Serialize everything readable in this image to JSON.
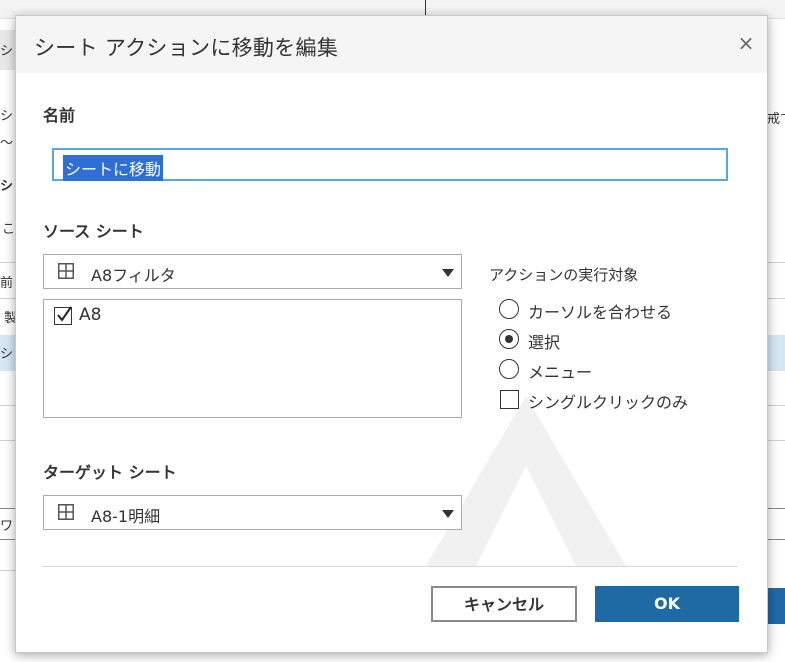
{
  "background": {
    "left_snippets": [
      "シ",
      "シ",
      "〜",
      "シ",
      "こ",
      "前",
      "製",
      "シ",
      "ワシ"
    ],
    "right_snippets": [
      "戒て"
    ]
  },
  "dialog": {
    "title": "シート アクションに移動を編集",
    "close_glyph": "×",
    "name_label": "名前",
    "name_value": "シートに移動",
    "source_label": "ソース シート",
    "source_dropdown": "A8フィルタ",
    "source_items": [
      {
        "label": "A8",
        "checked": true
      }
    ],
    "run_on_label": "アクションの実行対象",
    "run_on_options": [
      {
        "label": "カーソルを合わせる",
        "selected": false
      },
      {
        "label": "選択",
        "selected": true
      },
      {
        "label": "メニュー",
        "selected": false
      }
    ],
    "single_click_label": "シングルクリックのみ",
    "single_click_checked": false,
    "target_label": "ターゲット シート",
    "target_dropdown": "A8-1明細",
    "cancel_label": "キャンセル",
    "ok_label": "OK"
  },
  "colors": {
    "accent": "#1f6aa5",
    "selection": "#2f6fd3",
    "focus_border": "#5aa6e0"
  }
}
